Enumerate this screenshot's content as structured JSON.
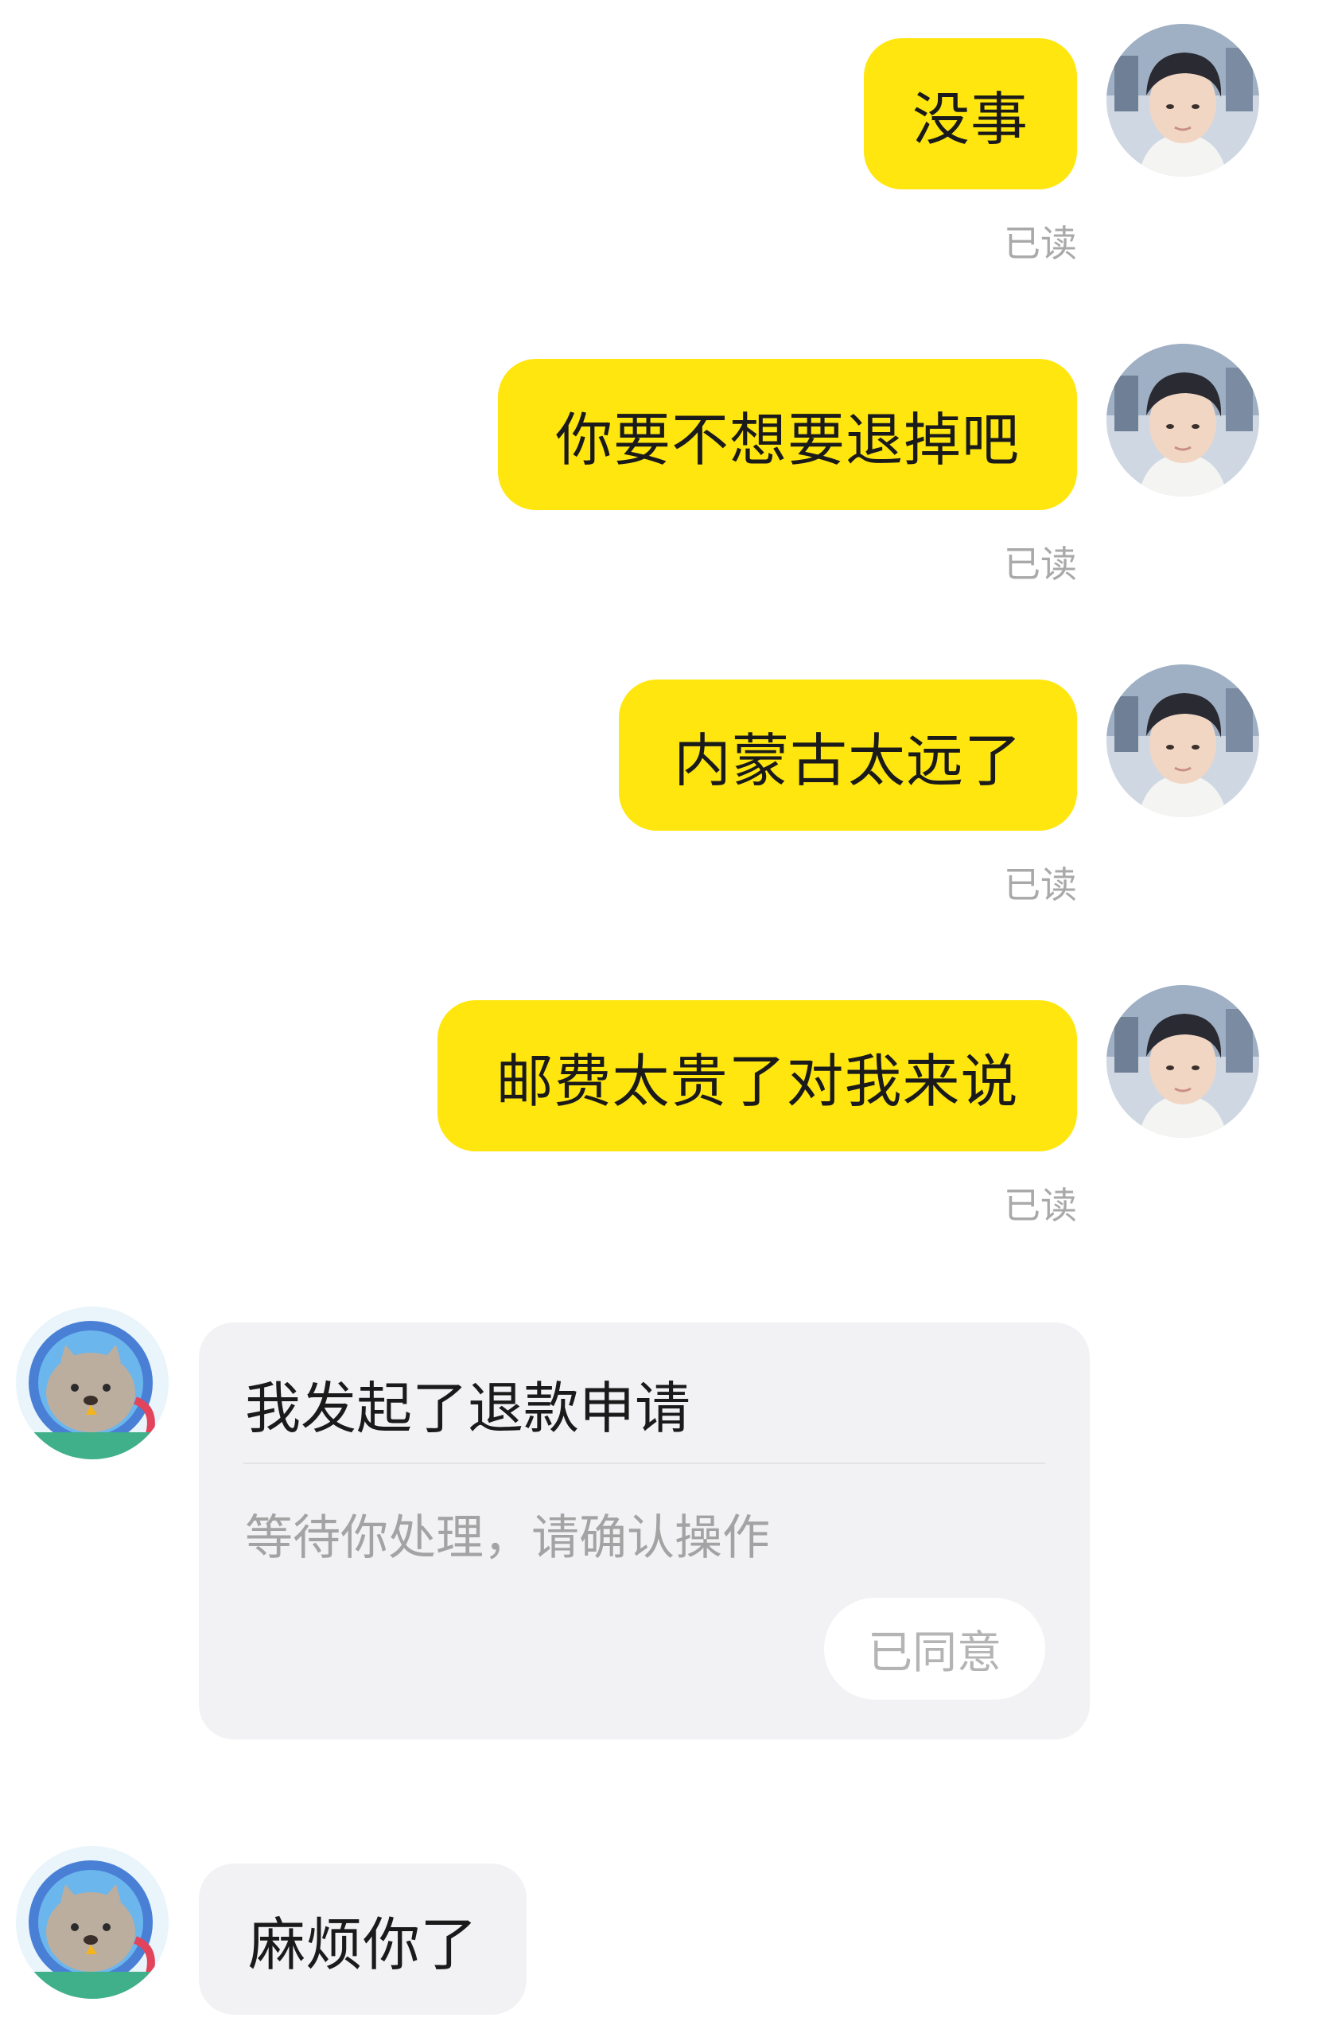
{
  "messages_out": [
    {
      "text": "没事",
      "status": "已读"
    },
    {
      "text": "你要不想要退掉吧",
      "status": "已读"
    },
    {
      "text": "内蒙古太远了",
      "status": "已读"
    },
    {
      "text": "邮费太贵了对我来说",
      "status": "已读"
    }
  ],
  "refund_card": {
    "title": "我发起了退款申请",
    "subtitle": "等待你处理，请确认操作",
    "button_label": "已同意"
  },
  "messages_in": [
    {
      "text": "麻烦你了"
    }
  ],
  "colors": {
    "outgoing_bubble": "#ffe60f",
    "incoming_bubble": "#f2f2f4",
    "read_status": "#a9a9a9"
  },
  "icons": {
    "self_avatar": "user-photo-avatar",
    "peer_avatar": "seal-astronaut-avatar"
  }
}
